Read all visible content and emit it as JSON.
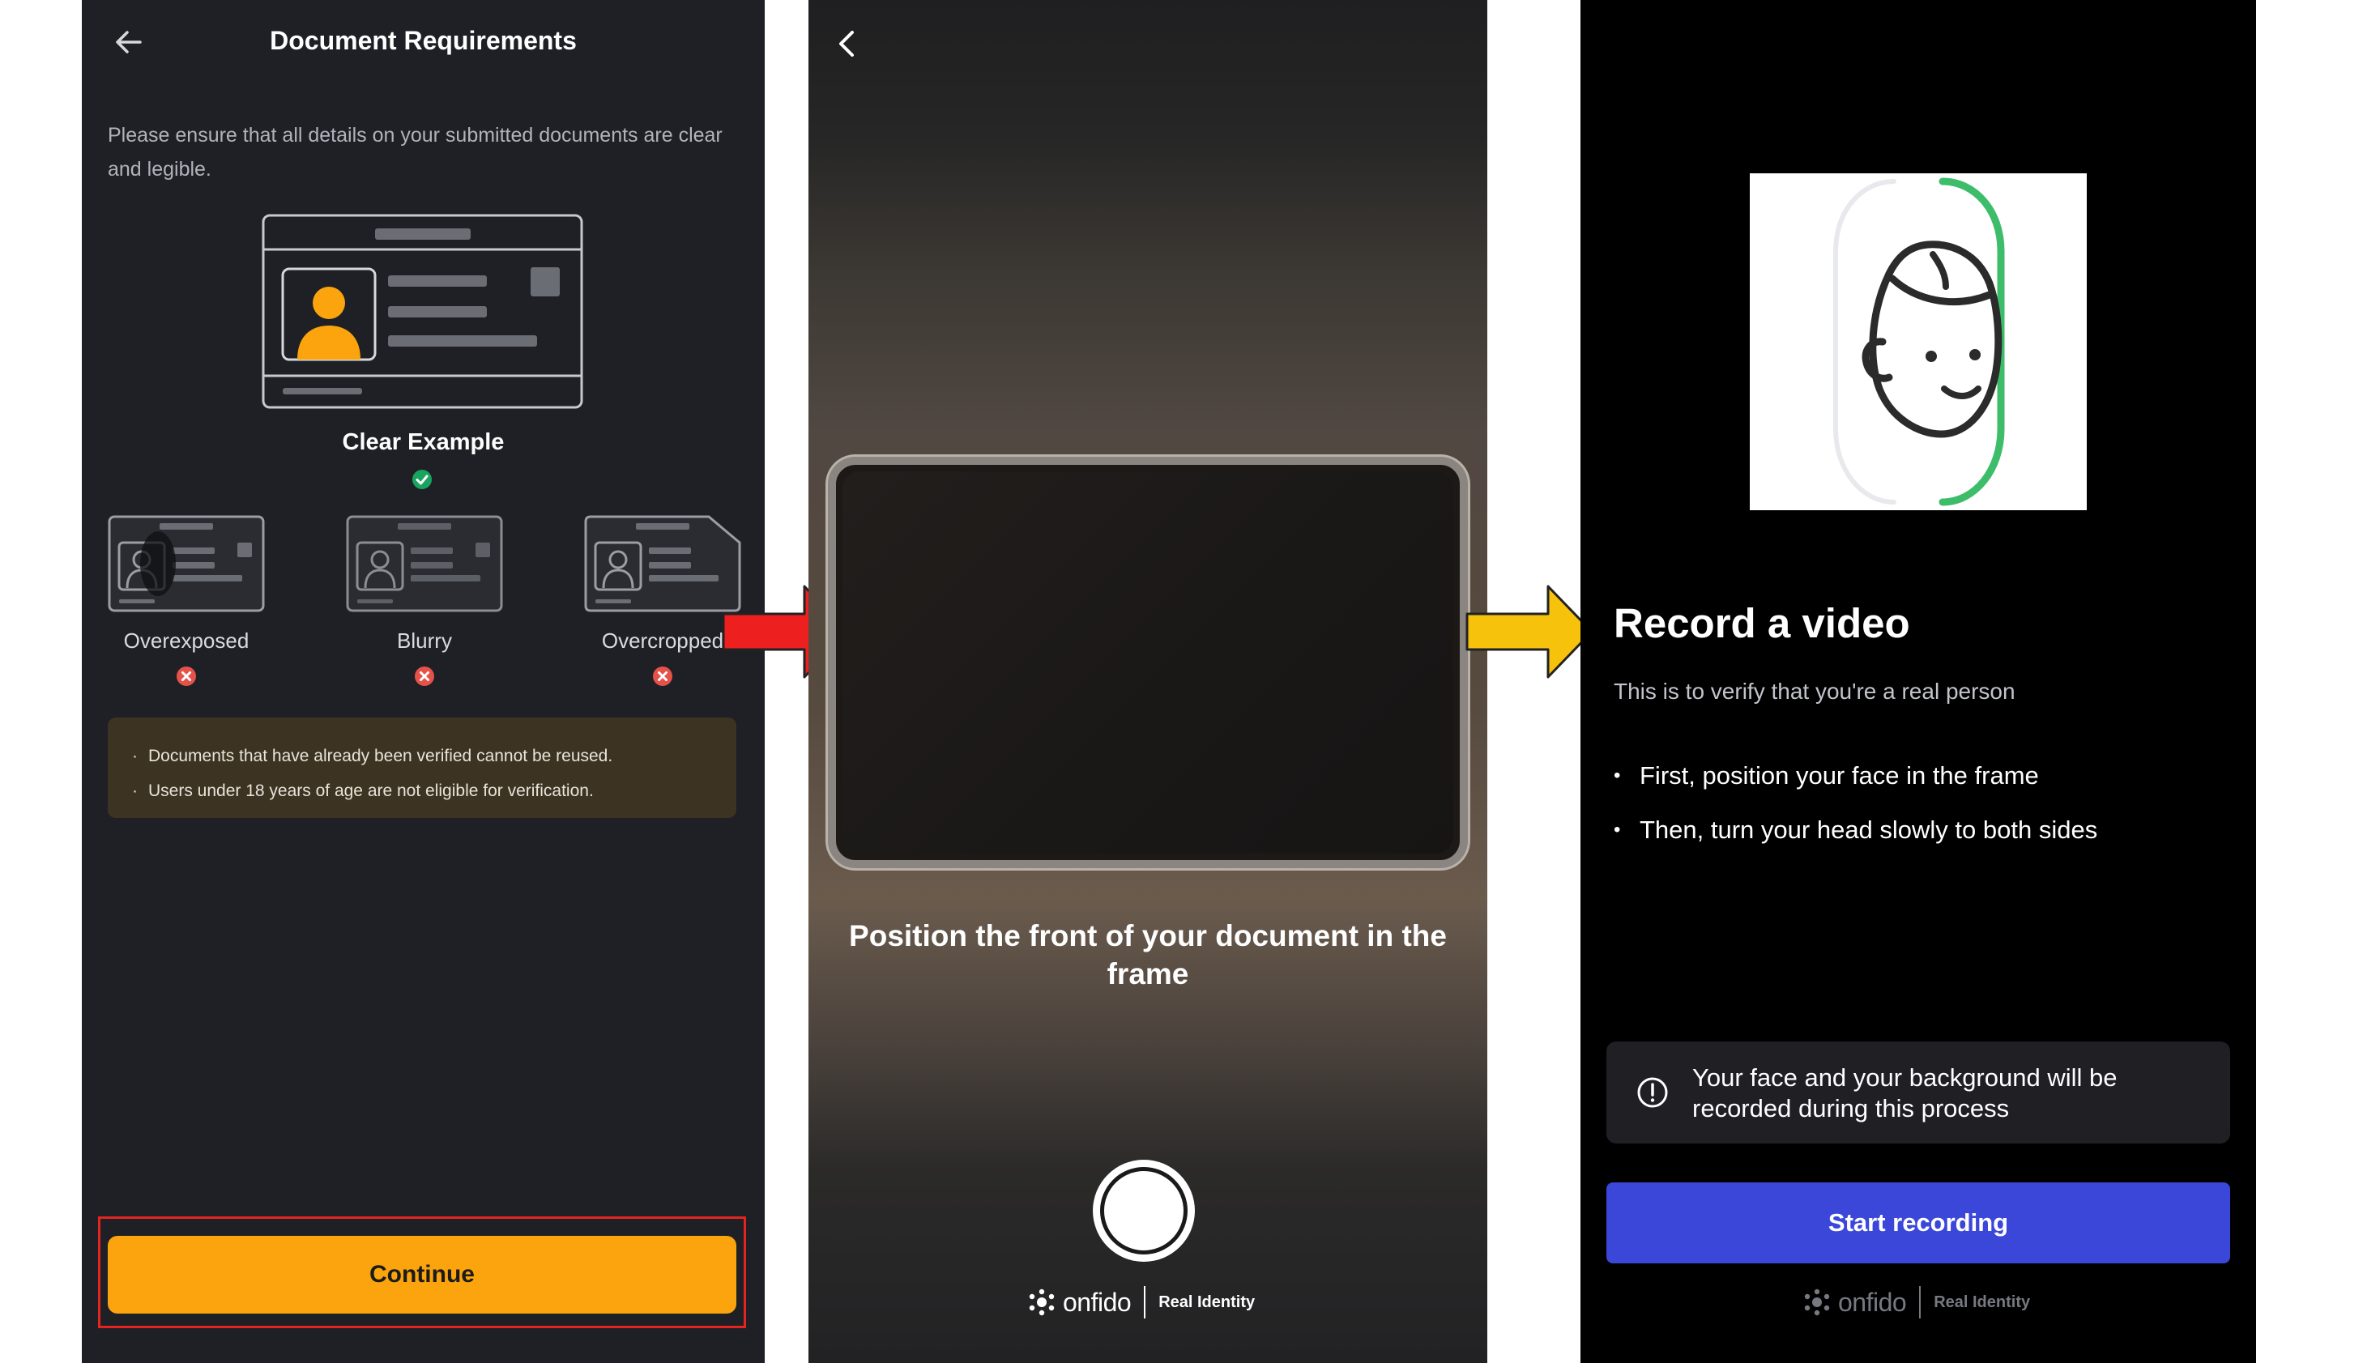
{
  "screen1": {
    "title": "Document Requirements",
    "intro": "Please ensure that all details on your submitted documents are clear and legible.",
    "clear_label": "Clear Example",
    "bad_examples": [
      {
        "label": "Overexposed"
      },
      {
        "label": "Blurry"
      },
      {
        "label": "Overcropped"
      }
    ],
    "notes": [
      "Documents that have already been verified cannot be reused.",
      "Users under 18 years of age are not eligible for verification."
    ],
    "continue_label": "Continue",
    "colors": {
      "background": "#1e2025",
      "accent": "#fba40d",
      "ok": "#1aa35f",
      "error": "#e5524a",
      "highlight_frame": "#e52420"
    }
  },
  "screen2": {
    "instruction": "Position the front of your document in the frame",
    "brand_name": "onfido",
    "brand_tag": "Real Identity"
  },
  "screen3": {
    "title": "Record a video",
    "subtitle": "This is to verify that you're a real person",
    "bullets": [
      "First, position your face in the frame",
      "Then, turn your head slowly to both sides"
    ],
    "info_text": "Your face and your background will be recorded during this process",
    "record_label": "Start recording",
    "brand_name": "onfido",
    "brand_tag": "Real Identity",
    "colors": {
      "primary": "#3a47d9",
      "progress_ring": "#3dbd6a"
    }
  },
  "arrows": {
    "first": "#ee1f1f",
    "second": "#f7c20c"
  },
  "icons": [
    "back-arrow-icon",
    "chevron-left-icon",
    "check-circle-icon",
    "x-circle-icon",
    "info-icon",
    "onfido-logo-icon",
    "face-icon"
  ]
}
